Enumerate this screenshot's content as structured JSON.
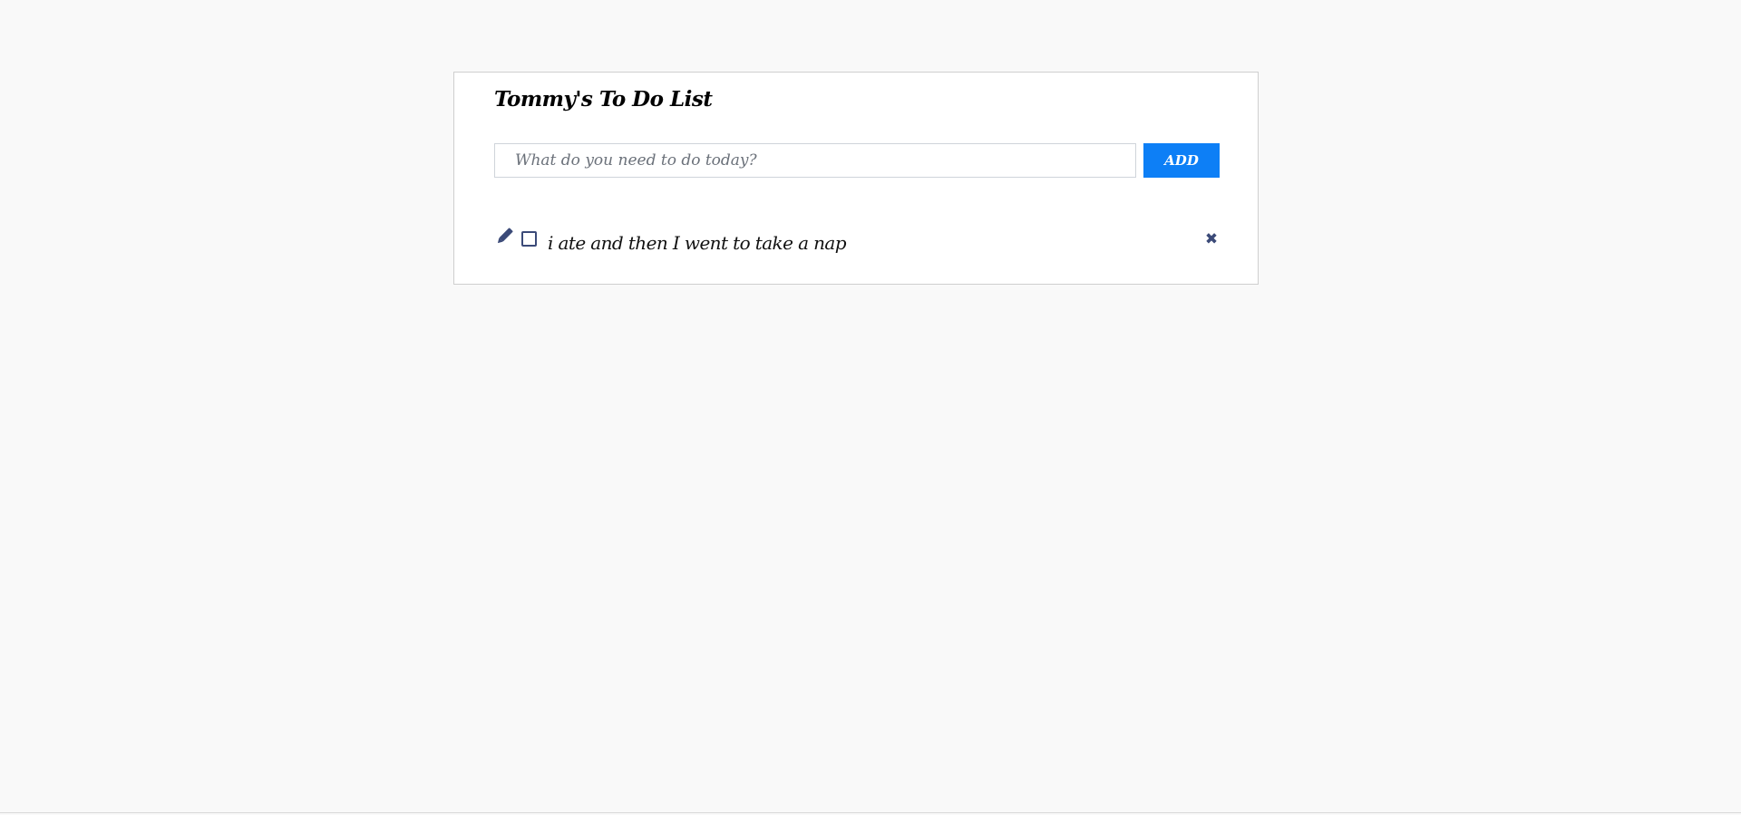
{
  "app": {
    "title": "Tommy's To Do List"
  },
  "new_todo": {
    "value": "",
    "placeholder": "What do you need to do today?",
    "add_label": "ADD"
  },
  "todos": [
    {
      "text": "i ate and then I went to take a nap",
      "completed": false
    }
  ],
  "icons": {
    "edit": "pencil-icon",
    "delete": "close-icon",
    "checkbox": "checkbox-unchecked"
  },
  "colors": {
    "accent": "#0d7ff6",
    "icon": "#3b4a78",
    "background": "#f9f9f9",
    "card": "#ffffff"
  }
}
